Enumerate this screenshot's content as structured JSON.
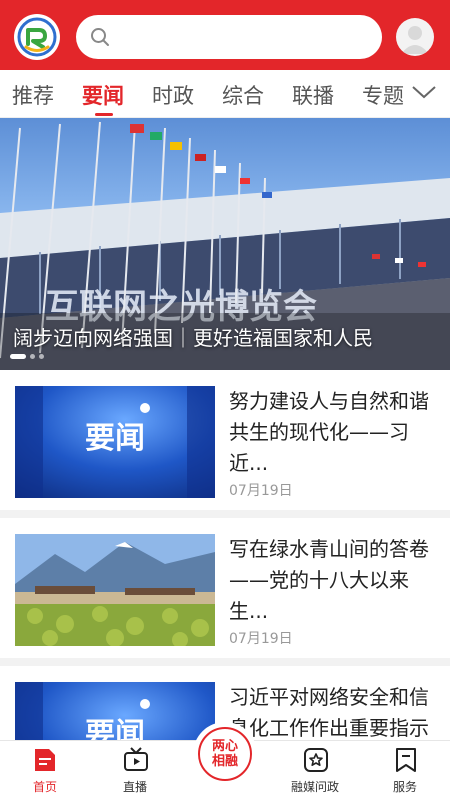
{
  "search": {
    "placeholder": ""
  },
  "tabs": [
    {
      "label": "推荐"
    },
    {
      "label": "要闻"
    },
    {
      "label": "时政"
    },
    {
      "label": "综合"
    },
    {
      "label": "联播"
    },
    {
      "label": "专题"
    }
  ],
  "banner": {
    "caption": "阔步迈向网络强国｜更好造福国家和人民",
    "sign_text": "互联网之光博览会",
    "slide_count": 3,
    "active_slide": 1
  },
  "news": [
    {
      "title": "努力建设人与自然和谐共生的现代化——习近...",
      "date": "07月19日",
      "thumb_text": "要闻"
    },
    {
      "title": "写在绿水青山间的答卷——党的十八大以来生...",
      "date": "07月19日"
    },
    {
      "title": "习近平对网络安全和信息化工作作出重要指示",
      "date": "",
      "thumb_text": "要闻"
    }
  ],
  "bottom_nav": {
    "items": [
      {
        "label": "首页",
        "icon": "home-doc-icon"
      },
      {
        "label": "直播",
        "icon": "tv-icon"
      },
      {
        "label": "融媒问政",
        "icon": "star-badge-icon"
      },
      {
        "label": "服务",
        "icon": "bookmark-icon"
      }
    ],
    "center": {
      "line1": "两心",
      "line2": "相融"
    }
  },
  "colors": {
    "brand_red": "#e3262a",
    "news_blue": "#1b4fb8",
    "date_gray": "#999999"
  }
}
